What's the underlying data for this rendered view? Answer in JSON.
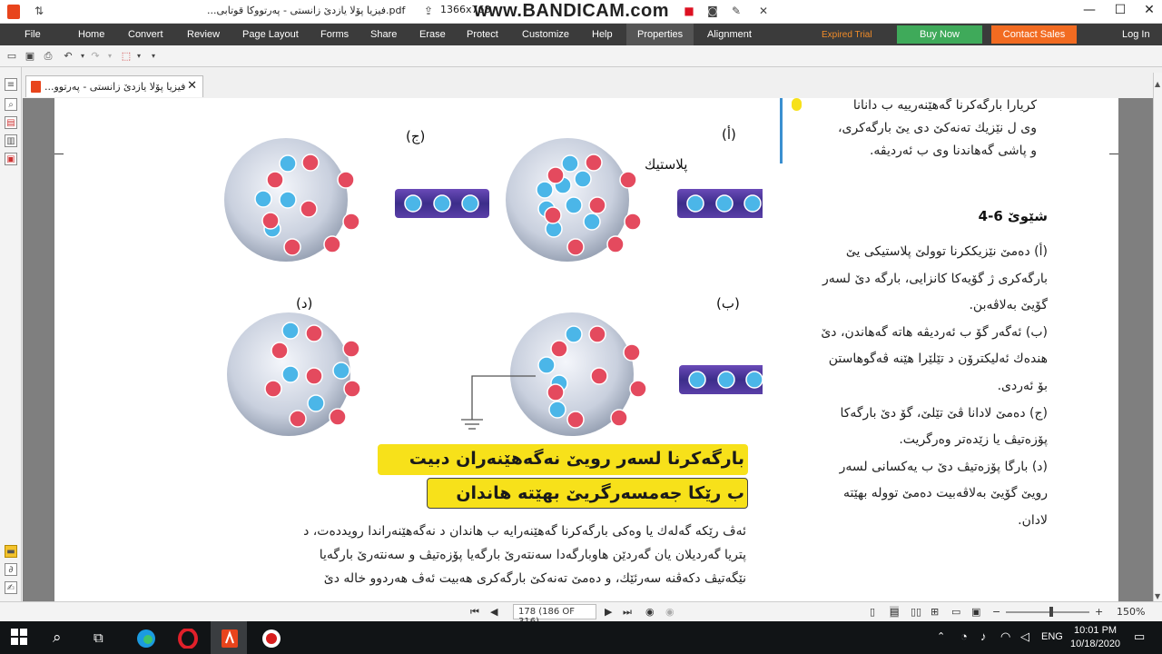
{
  "titlebar": {
    "title": "...فيزيا پۆلا يازدێ زانستی - پەرتووکا قوتابی.pdf",
    "resolution": "1366x768",
    "watermark": "www.BANDICAM.com"
  },
  "menu": {
    "items": [
      "File",
      "Home",
      "Convert",
      "Review",
      "Page Layout",
      "Forms",
      "Share",
      "Erase",
      "Protect",
      "Customize",
      "Help",
      "Properties",
      "Alignment"
    ],
    "active": "Properties",
    "expired": "Expired Trial",
    "buy": "Buy Now",
    "contact": "Contact Sales",
    "login": "Log In",
    "colors": {
      "buy": "#3faa5a",
      "contact": "#f26b21",
      "expired": "#f28c28"
    }
  },
  "tab": {
    "label": "...فيزيا پۆلا يازدێ زانستی - پەرتوو"
  },
  "figure": {
    "label_a": "(أ)",
    "label_b": "(ب)",
    "label_c": "(ج)",
    "label_d": "(د)",
    "plastic": "پلاستیك"
  },
  "top_text": [
    "كريارا بارگەكرنا گەهێنەرييە ب دانانا",
    "وى ل نێزيك تەنەكێ دى يێ بارگەكرى،",
    "و پاشى گەهاندنا وى ب ئەرديڤە."
  ],
  "figure_caption": {
    "title": "شێوێ 6-4",
    "lines": [
      "(أ) دەمێ نێزيككرنا توولێ پلاستيكى يێ",
      "بارگەكرى ژ گۆيەكا كانزايى، بارگە دێ لسەر",
      "گۆيێ بەلاڤەبن.",
      "(ب) ئەگەر گۆ ب ئەرديڤە هاتە گەهاندن، دێ",
      "هندەك ئەليكترۆن د تێلێرا هێنە ڤەگوهاستن",
      "بۆ ئەردى.",
      "(ج) دەمێ لادانا ڤێ تێلێ، گۆ دێ بارگەكا",
      "پۆزەتيڤ يا زێدەتر وەرگريت.",
      "(د) بارگا پۆزەتيڤ دێ ب يەكسانى لسەر",
      "رويێ گۆيێ بەلاڤەبيت دەمێ توولە بهێتە",
      "لادان."
    ]
  },
  "heading": {
    "line1": "بارگەكرنا لسەر رويێ نەگەهێنەران دبيت",
    "line2": "ب رێكا جەمسەرگريێ بهێتە هاندان"
  },
  "body_lines": [
    "ئەڤ رێكە گەلەك يا وەكى بارگەكرنا گەهێنەرايە ب هاندان د نەگەهێنەراندا رويددەت، د",
    "پتريا گەرديلان يان گەردێن هاوبارگەدا سەنتەرێ بارگەيا پۆزەتيڤ و سەنتەرێ بارگەيا",
    "نێگەتيڤ دكەڤنە سەرئێك، و دەمێ تەنەكێ بارگەكرى هەبيت ئەڤ هەردوو خالە دێ"
  ],
  "status": {
    "page": "178 (186 OF 316)",
    "zoom": "150%"
  },
  "taskbar": {
    "lang": "ENG",
    "time": "10:01 PM",
    "date": "10/18/2020"
  }
}
